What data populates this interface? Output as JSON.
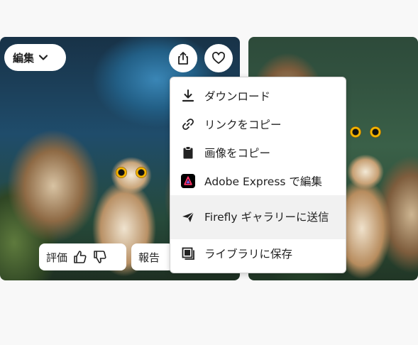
{
  "toolbar": {
    "edit_label": "編集",
    "edit_icon": "chevron-down-icon",
    "share_icon": "share-icon",
    "like_icon": "heart-icon"
  },
  "feedback": {
    "rate_label": "評価",
    "thumbs_up_icon": "thumbs-up-icon",
    "thumbs_down_icon": "thumbs-down-icon",
    "report_label": "報告"
  },
  "menu": {
    "items": [
      {
        "label": "ダウンロード",
        "icon": "download-icon"
      },
      {
        "label": "リンクをコピー",
        "icon": "link-icon"
      },
      {
        "label": "画像をコピー",
        "icon": "clipboard-icon"
      },
      {
        "label": "Adobe Express で編集",
        "icon": "adobe-express-icon"
      },
      {
        "label": "Firefly ギャラリーに送信",
        "icon": "send-icon"
      },
      {
        "label": "ライブラリに保存",
        "icon": "library-icon"
      }
    ]
  },
  "colors": {
    "menu_bg": "#ffffff",
    "hover_bg": "#f1f1f1",
    "page_bg": "#f8f8f8"
  }
}
